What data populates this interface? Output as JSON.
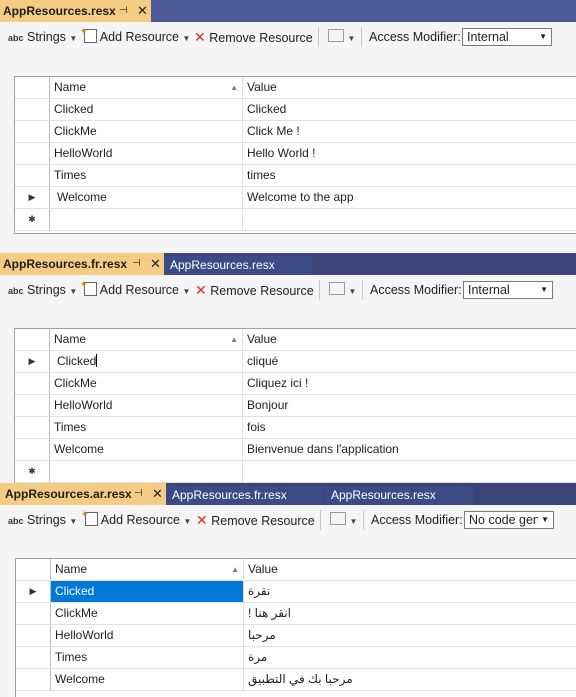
{
  "toolbar": {
    "strings_label": "Strings",
    "add_resource_label": "Add Resource",
    "remove_resource_label": "Remove Resource",
    "access_modifier_label": "Access Modifier:"
  },
  "grid": {
    "name_header": "Name",
    "value_header": "Value"
  },
  "editors": [
    {
      "active_tab": "AppResources.resx",
      "inactive_tabs": [],
      "access_modifier": "Internal",
      "rows": [
        {
          "name": "Clicked",
          "value": "Clicked"
        },
        {
          "name": "ClickMe",
          "value": "Click Me !"
        },
        {
          "name": "HelloWorld",
          "value": "Hello World !"
        },
        {
          "name": "Times",
          "value": "times"
        },
        {
          "name": "Welcome",
          "value": "Welcome to the app"
        }
      ]
    },
    {
      "active_tab": "AppResources.fr.resx",
      "inactive_tabs": [
        "AppResources.resx"
      ],
      "access_modifier": "Internal",
      "rows": [
        {
          "name": "Clicked",
          "value": "cliqué"
        },
        {
          "name": "ClickMe",
          "value": "Cliquez ici !"
        },
        {
          "name": "HelloWorld",
          "value": "Bonjour"
        },
        {
          "name": "Times",
          "value": "fois"
        },
        {
          "name": "Welcome",
          "value": "Bienvenue dans l'application"
        }
      ]
    },
    {
      "active_tab": "AppResources.ar.resx",
      "inactive_tabs": [
        "AppResources.fr.resx",
        "AppResources.resx"
      ],
      "access_modifier": "No code gene",
      "rows": [
        {
          "name": "Clicked",
          "value": "نقرة"
        },
        {
          "name": "ClickMe",
          "value": "انقر هنا !"
        },
        {
          "name": "HelloWorld",
          "value": "مرحبا"
        },
        {
          "name": "Times",
          "value": "مرة"
        },
        {
          "name": "Welcome",
          "value": "مرحبا بك في التطبيق"
        }
      ]
    }
  ],
  "colors": {
    "tab_active": "#f5cc84",
    "tab_bar": "#4d5997",
    "tab_inactive": "#3c4b85",
    "selection": "#0078d7"
  }
}
